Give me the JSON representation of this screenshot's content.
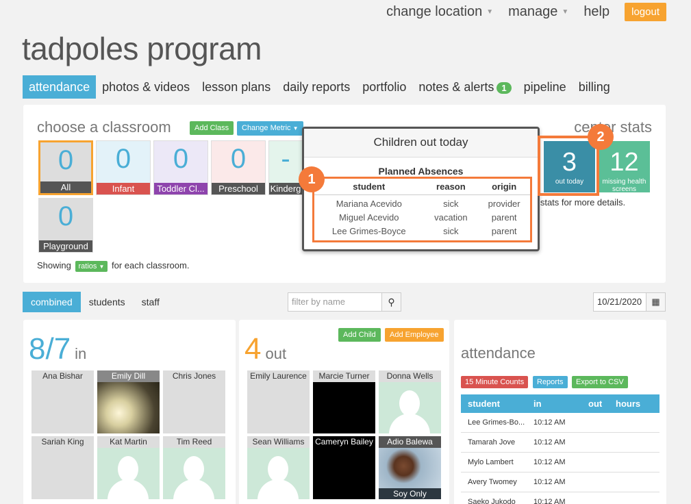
{
  "topnav": {
    "change_location": "change location",
    "manage": "manage",
    "help": "help",
    "logout": "logout"
  },
  "program_title": "tadpoles program",
  "tabs": [
    {
      "label": "attendance"
    },
    {
      "label": "photos & videos"
    },
    {
      "label": "lesson plans"
    },
    {
      "label": "daily reports"
    },
    {
      "label": "portfolio"
    },
    {
      "label": "notes & alerts",
      "badge": "1"
    },
    {
      "label": "pipeline"
    },
    {
      "label": "billing"
    }
  ],
  "classroom": {
    "title": "choose a classroom",
    "add_class": "Add Class",
    "change_metric": "Change Metric",
    "tiles": [
      {
        "count": "0",
        "label": "All",
        "color": "#555555"
      },
      {
        "count": "0",
        "label": "Infant",
        "color": "#d9534f"
      },
      {
        "count": "0",
        "label": "Toddler Cl...",
        "color": "#8e44ad"
      },
      {
        "count": "0",
        "label": "Preschool",
        "color": "#555555"
      },
      {
        "count": "-",
        "label": "Kinderg",
        "color": "#555555"
      },
      {
        "count": "0",
        "label": "Playground",
        "color": "#555555"
      }
    ],
    "showing_prefix": "Showing",
    "ratios": "ratios",
    "showing_suffix": "for each classroom."
  },
  "center_stats": {
    "title": "center stats",
    "out_today": {
      "value": "3",
      "label": "out today"
    },
    "missing": {
      "value": "12",
      "label": "missing health screens"
    },
    "hover_hint": "r over stats for more details."
  },
  "popup": {
    "title": "Children out today",
    "subtitle": "Planned Absences",
    "headers": [
      "student",
      "reason",
      "origin"
    ],
    "rows": [
      [
        "Mariana Acevido",
        "sick",
        "provider"
      ],
      [
        "Miguel Acevido",
        "vacation",
        "parent"
      ],
      [
        "Lee Grimes-Boyce",
        "sick",
        "parent"
      ]
    ]
  },
  "markers": {
    "m1": "1",
    "m2": "2"
  },
  "filters": {
    "combined": "combined",
    "students": "students",
    "staff": "staff",
    "search_placeholder": "filter by name",
    "date": "10/21/2020"
  },
  "in_panel": {
    "count": "8/7",
    "label": "in",
    "kids": [
      "Ana Bishar",
      "Emily Dill",
      "Chris Jones",
      "Sariah King",
      "Kat Martin",
      "Tim Reed"
    ]
  },
  "out_panel": {
    "count": "4",
    "label": "out",
    "add_child": "Add Child",
    "add_employee": "Add Employee",
    "kids": [
      "Emily Laurence",
      "Marcie Turner",
      "Donna Wells",
      "Sean Williams",
      "Cameryn Bailey",
      "Adio Balewa"
    ],
    "soy_only": "Soy Only"
  },
  "attendance": {
    "title": "attendance",
    "btn_counts": "15 Minute Counts",
    "btn_reports": "Reports",
    "btn_export": "Export to CSV",
    "headers": [
      "student",
      "in",
      "out",
      "hours"
    ],
    "rows": [
      [
        "Lee Grimes-Bo...",
        "10:12 AM"
      ],
      [
        "Tamarah Jove",
        "10:12 AM"
      ],
      [
        "Mylo Lambert",
        "10:12 AM"
      ],
      [
        "Avery Twomey",
        "10:12 AM"
      ],
      [
        "Saeko Jukodo",
        "10:12 AM"
      ]
    ]
  }
}
